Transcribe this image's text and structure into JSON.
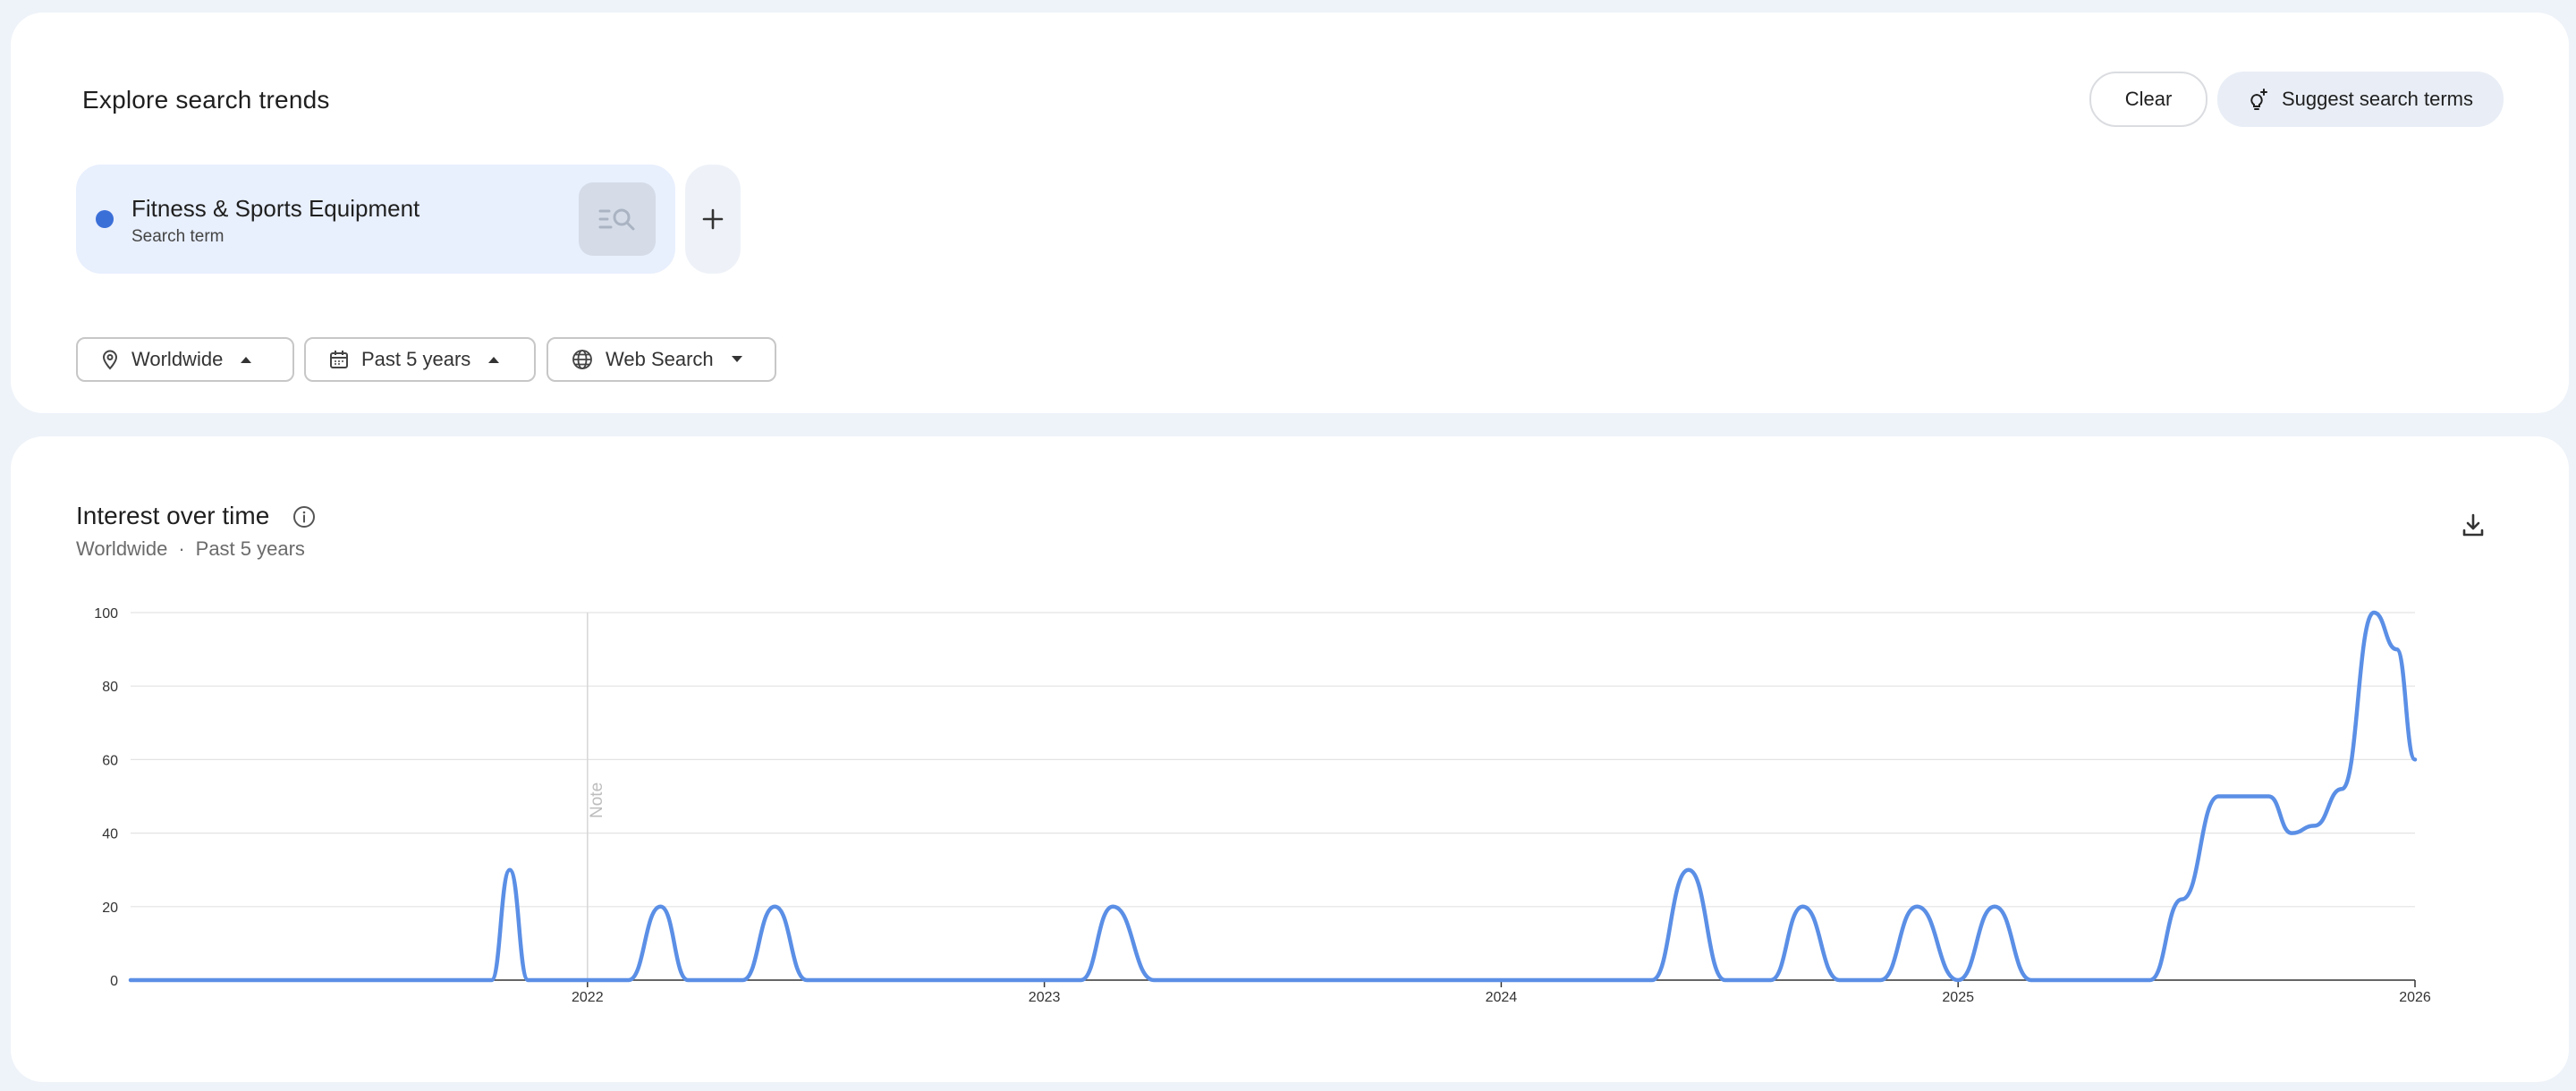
{
  "explore": {
    "title": "Explore search trends",
    "clear_label": "Clear",
    "suggest_label": "Suggest search terms"
  },
  "term": {
    "name": "Fitness & Sports Equipment",
    "type": "Search term",
    "color": "#3b6fd8"
  },
  "filters": {
    "geo": "Worldwide",
    "time": "Past 5 years",
    "property": "Web Search"
  },
  "icons": {
    "suggest": "sparkle-bulb-icon",
    "term_search": "search-list-icon",
    "add": "plus-icon",
    "geo": "location-pin-icon",
    "time": "calendar-icon",
    "property": "globe-icon",
    "info": "info-icon",
    "download": "download-icon"
  },
  "interest": {
    "title": "Interest over time",
    "sub_geo": "Worldwide",
    "sub_sep": "·",
    "sub_time": "Past 5 years"
  },
  "chart_data": {
    "type": "line",
    "title": "Interest over time",
    "xlabel": "",
    "ylabel": "",
    "ylim": [
      0,
      100
    ],
    "yticks": [
      0,
      20,
      40,
      60,
      80,
      100
    ],
    "xlim": [
      2021.0,
      2026.0
    ],
    "xticks": [
      {
        "label": "2022",
        "value": 2022.0
      },
      {
        "label": "2023",
        "value": 2023.0
      },
      {
        "label": "2024",
        "value": 2024.0
      },
      {
        "label": "2025",
        "value": 2025.0
      },
      {
        "label": "2026",
        "value": 2026.0
      }
    ],
    "grid": true,
    "annotation": {
      "label": "Note",
      "x": 2022.0
    },
    "line_color": "#5b8fe6",
    "series": [
      {
        "name": "Fitness & Sports Equipment",
        "points": [
          [
            2021.0,
            0
          ],
          [
            2021.75,
            0
          ],
          [
            2021.79,
            0
          ],
          [
            2021.83,
            30
          ],
          [
            2021.87,
            0
          ],
          [
            2021.91,
            0
          ],
          [
            2022.0,
            0
          ],
          [
            2022.09,
            0
          ],
          [
            2022.16,
            20
          ],
          [
            2022.22,
            0
          ],
          [
            2022.34,
            0
          ],
          [
            2022.41,
            20
          ],
          [
            2022.48,
            0
          ],
          [
            2023.0,
            0
          ],
          [
            2023.08,
            0
          ],
          [
            2023.15,
            20
          ],
          [
            2023.24,
            0
          ],
          [
            2024.0,
            0
          ],
          [
            2024.33,
            0
          ],
          [
            2024.41,
            30
          ],
          [
            2024.49,
            0
          ],
          [
            2024.59,
            0
          ],
          [
            2024.66,
            20
          ],
          [
            2024.74,
            0
          ],
          [
            2024.83,
            0
          ],
          [
            2024.91,
            20
          ],
          [
            2025.0,
            0
          ],
          [
            2025.08,
            20
          ],
          [
            2025.16,
            0
          ],
          [
            2025.42,
            0
          ],
          [
            2025.49,
            22
          ],
          [
            2025.57,
            50
          ],
          [
            2025.68,
            50
          ],
          [
            2025.73,
            40
          ],
          [
            2025.78,
            42
          ],
          [
            2025.84,
            52
          ],
          [
            2025.91,
            100
          ],
          [
            2025.96,
            90
          ],
          [
            2026.0,
            60
          ]
        ]
      }
    ]
  }
}
